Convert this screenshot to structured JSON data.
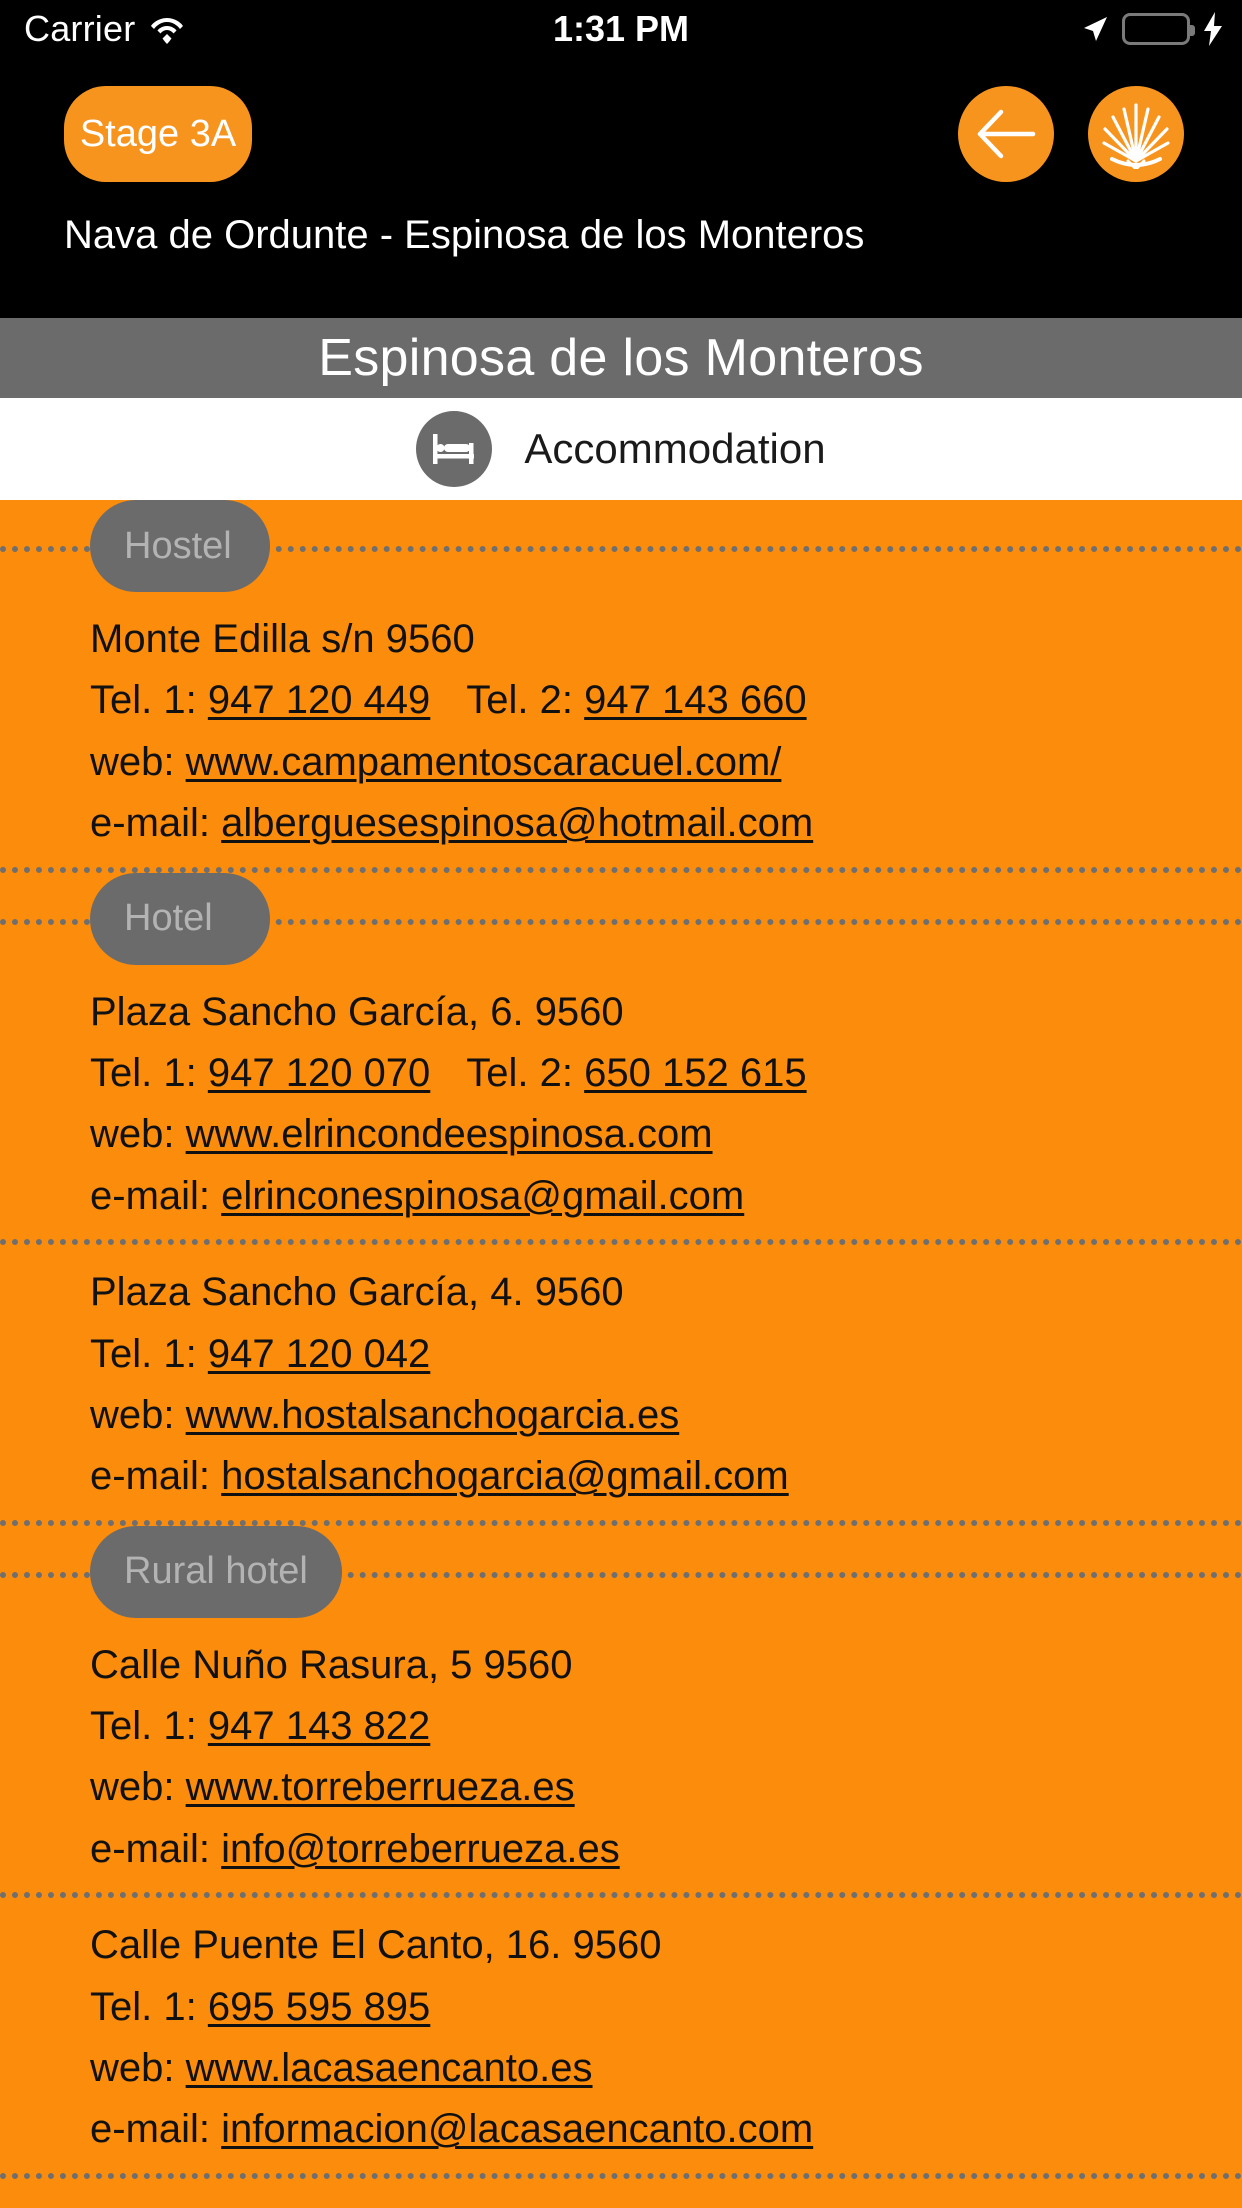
{
  "status_bar": {
    "carrier": "Carrier",
    "time": "1:31 PM",
    "wifi_icon": "wifi-icon",
    "location_icon": "location-arrow-icon",
    "battery_icon": "battery-full-icon",
    "charging_icon": "lightning-bolt-icon",
    "battery_color": "#4CD964"
  },
  "nav": {
    "stage_label": "Stage 3A",
    "back_icon": "back-arrow-icon",
    "shell_icon": "scallop-shell-icon",
    "subtitle": "Nava de Ordunte - Espinosa de los Monteros",
    "accent_color": "#F7941E"
  },
  "place": {
    "title": "Espinosa de los Monteros",
    "bar_color": "#6B6B6B"
  },
  "category": {
    "icon": "bed-icon",
    "label": "Accommodation"
  },
  "listing_colors": {
    "background": "#FC8C0C",
    "pill_background": "#6B6B6B",
    "pill_text": "#B3B3B3",
    "separator": "#6F6F6F"
  },
  "labels": {
    "tel1": "Tel. 1:",
    "tel2": "Tel. 2:",
    "web": "web:",
    "email": "e-mail:"
  },
  "sections": [
    {
      "pill": "Hostel",
      "entries": [
        {
          "address": "Monte Edilla s/n 9560",
          "tel1": "947 120 449",
          "tel2": "947 143 660",
          "web": "www.campamentoscaracuel.com/",
          "email": "alberguesespinosa@hotmail.com"
        }
      ]
    },
    {
      "pill": "Hotel",
      "entries": [
        {
          "address": "Plaza Sancho García, 6. 9560",
          "tel1": "947 120 070",
          "tel2": "650 152 615",
          "web": "www.elrincondeespinosa.com",
          "email": "elrinconespinosa@gmail.com"
        },
        {
          "address": "Plaza Sancho García, 4. 9560",
          "tel1": "947 120 042",
          "tel2": "",
          "web": "www.hostalsanchogarcia.es",
          "email": "hostalsanchogarcia@gmail.com"
        }
      ]
    },
    {
      "pill": "Rural hotel",
      "entries": [
        {
          "address": "Calle Nuño Rasura, 5 9560",
          "tel1": "947 143 822",
          "tel2": "",
          "web": "www.torreberrueza.es",
          "email": "info@torreberrueza.es"
        },
        {
          "address": "Calle Puente El Canto, 16.  9560",
          "tel1": "695 595 895",
          "tel2": "",
          "web": "www.lacasaencanto.es",
          "email": "informacion@lacasaencanto.com"
        }
      ]
    }
  ]
}
